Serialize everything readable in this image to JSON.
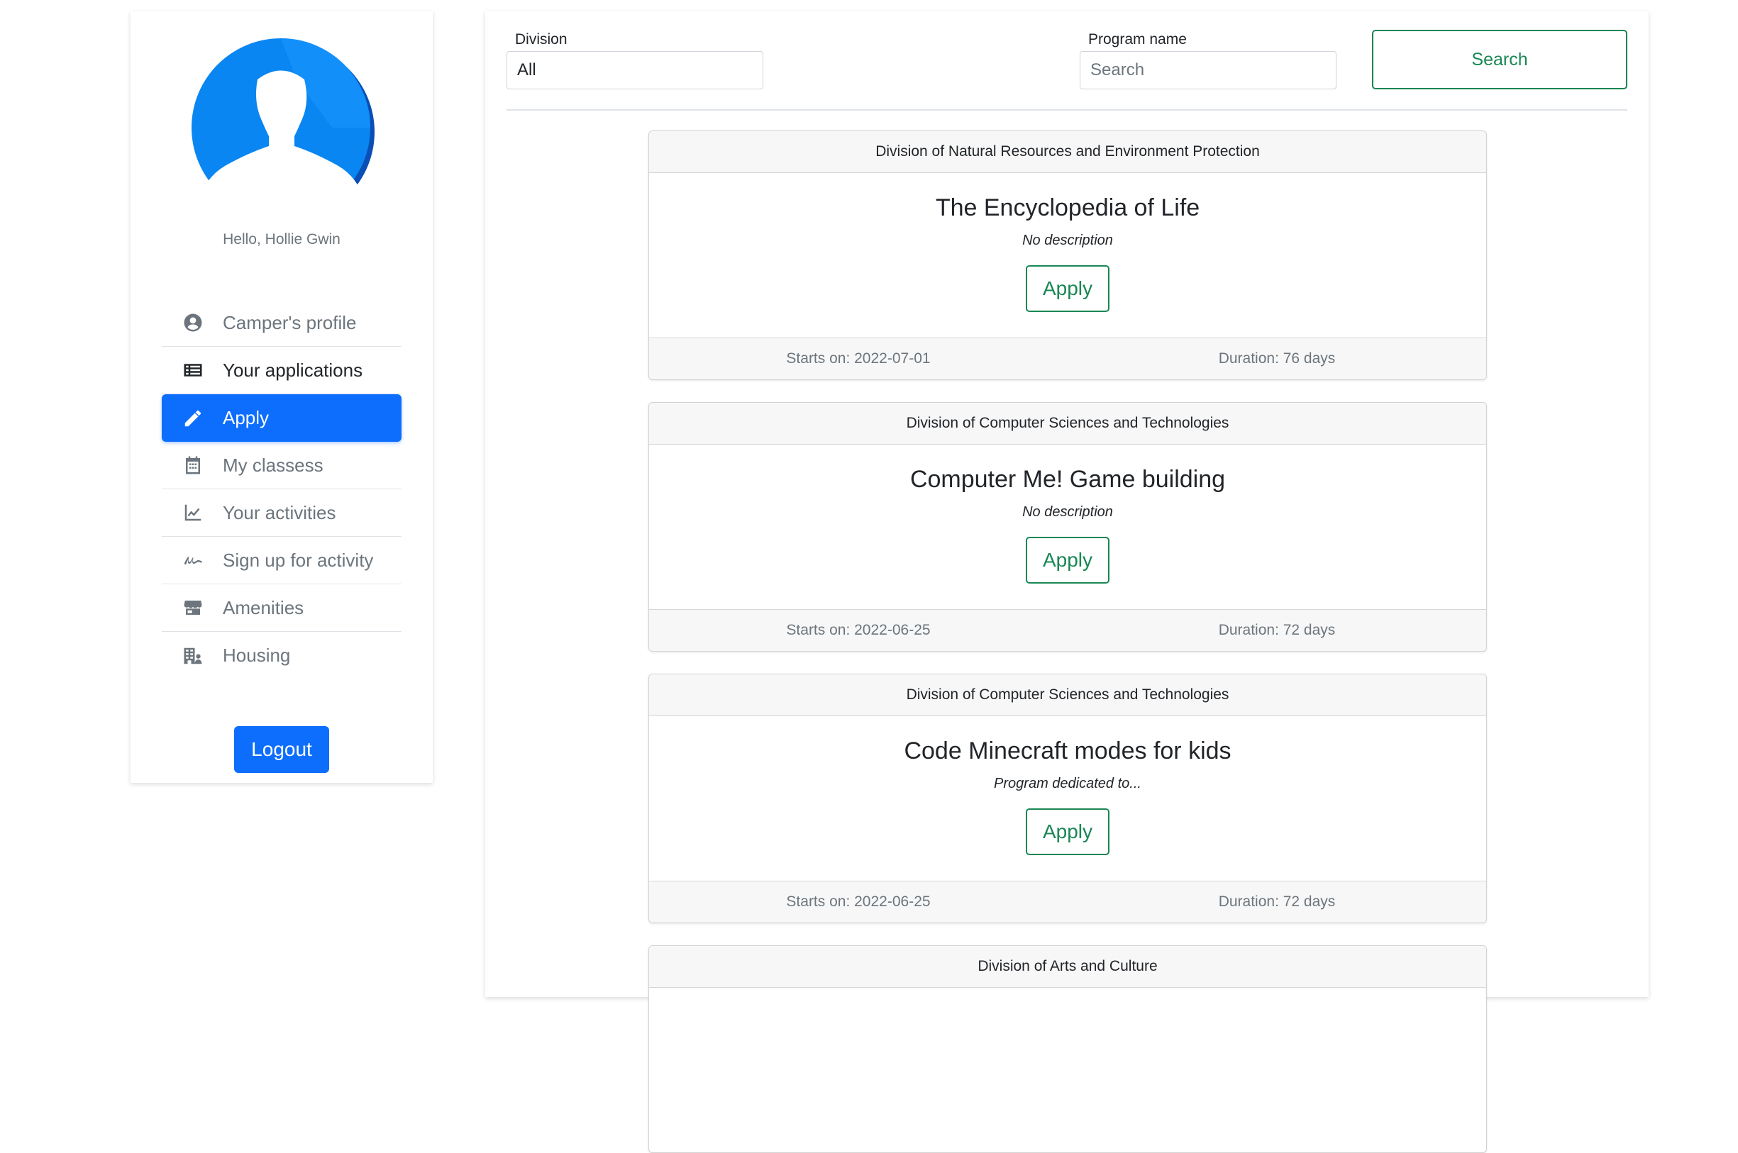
{
  "user": {
    "greeting": "Hello, Hollie Gwin"
  },
  "sidebar": {
    "items": [
      {
        "label": "Camper's profile",
        "icon": "user-circle-icon"
      },
      {
        "label": "Your applications",
        "icon": "list-icon"
      },
      {
        "label": "Apply",
        "icon": "pencil-icon",
        "active": true
      },
      {
        "label": "My classess",
        "icon": "calendar-icon"
      },
      {
        "label": "Your activities",
        "icon": "chart-line-icon"
      },
      {
        "label": "Sign up for activity",
        "icon": "signature-icon"
      },
      {
        "label": "Amenities",
        "icon": "store-icon"
      },
      {
        "label": "Housing",
        "icon": "building-user-icon"
      }
    ],
    "logout_label": "Logout"
  },
  "filters": {
    "division_label": "Division",
    "division_value": "All",
    "program_label": "Program name",
    "program_placeholder": "Search",
    "search_label": "Search"
  },
  "programs": [
    {
      "division": "Division of Natural Resources and Environment Protection",
      "title": "The Encyclopedia of Life",
      "description": "No description",
      "apply_label": "Apply",
      "starts": "Starts on: 2022-07-01",
      "duration": "Duration: 76 days"
    },
    {
      "division": "Division of Computer Sciences and Technologies",
      "title": "Computer Me! Game building",
      "description": "No description",
      "apply_label": "Apply",
      "starts": "Starts on: 2022-06-25",
      "duration": "Duration: 72 days"
    },
    {
      "division": "Division of Computer Sciences and Technologies",
      "title": "Code Minecraft modes for kids",
      "description": "Program dedicated to...",
      "apply_label": "Apply",
      "starts": "Starts on: 2022-06-25",
      "duration": "Duration: 72 days"
    },
    {
      "division": "Division of Arts and Culture"
    }
  ],
  "colors": {
    "primary": "#0d6efd",
    "success": "#198754",
    "muted": "#6c757d"
  }
}
